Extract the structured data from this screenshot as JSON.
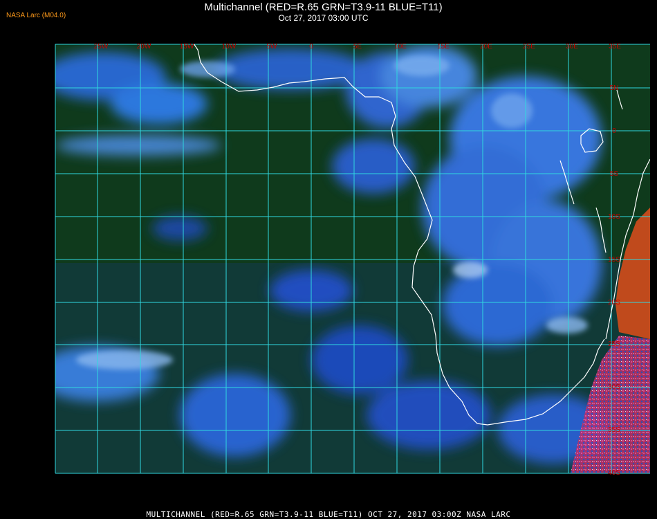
{
  "header": {
    "credit": "NASA Larc (M04.0)",
    "title": "Multichannel (RED=R.65 GRN=T3.9-11 BLUE=T11)",
    "subtitle": "Oct 27, 2017 03:00 UTC"
  },
  "footer": {
    "caption": "MULTICHANNEL (RED=R.65 GRN=T3.9-11 BLUE=T11) OCT 27, 2017 03:00Z  NASA LARC"
  },
  "map": {
    "longitude_labels": [
      "25W",
      "20W",
      "15W",
      "10W",
      "5W",
      "0",
      "5E",
      "10E",
      "15E",
      "20E",
      "25E",
      "30E",
      "35E"
    ],
    "latitude_labels": [
      "5N",
      "0",
      "5S",
      "10S",
      "15S",
      "20S",
      "25S",
      "30S",
      "35S",
      "40S"
    ],
    "colors": {
      "grid": "#2fd8e0",
      "coastline": "#ffffff",
      "grid_label": "#c80000",
      "ocean": "#0f3a1c",
      "cloud": "#2a72e6",
      "land_hot": "#c04a1c"
    }
  }
}
